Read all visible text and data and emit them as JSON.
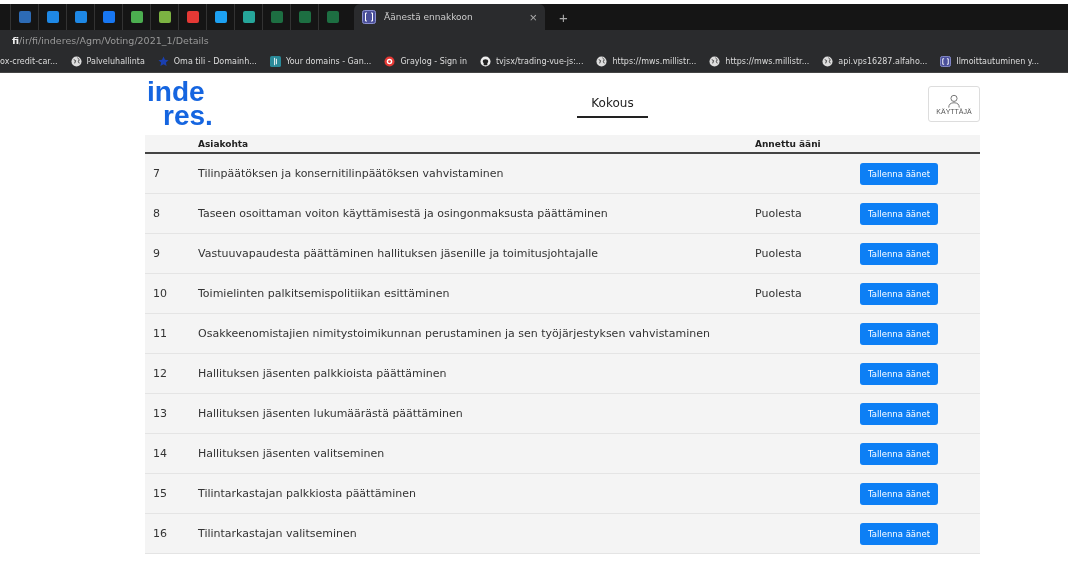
{
  "browser": {
    "pinned_tabs": [
      {
        "color": "#2d6bb5"
      },
      {
        "color": "#1e88e5"
      },
      {
        "color": "#1e88e5"
      },
      {
        "color": "#1877f2"
      },
      {
        "color": "#4caf50"
      },
      {
        "color": "#7cb342"
      },
      {
        "color": "#e53935"
      },
      {
        "color": "#1da1f2"
      },
      {
        "color": "#26a69a"
      },
      {
        "color": "#1d6f42"
      },
      {
        "color": "#1d6f42"
      },
      {
        "color": "#1d6f42"
      }
    ],
    "active_tab": {
      "title": "Äänestä ennakkoon",
      "close": "×"
    },
    "new_tab": "+",
    "address": "**fi**/ir/fi/inderes/Agm/Voting/2021_1/Details",
    "bookmarks": [
      {
        "kind": "none",
        "label": "ox-credit-car..."
      },
      {
        "kind": "globe",
        "label": "Palveluhallinta"
      },
      {
        "kind": "star",
        "label": "Oma tili - Domainh..."
      },
      {
        "kind": "tile",
        "label": "Your domains - Gan..."
      },
      {
        "kind": "target",
        "label": "Graylog - Sign in"
      },
      {
        "kind": "github",
        "label": "tvjsx/trading-vue-js:..."
      },
      {
        "kind": "globe",
        "label": "https://mws.millistr..."
      },
      {
        "kind": "globe",
        "label": "https://mws.millistr..."
      },
      {
        "kind": "globe",
        "label": "api.vps16287.alfaho..."
      },
      {
        "kind": "bracket",
        "label": "Ilmoittautuminen y..."
      }
    ]
  },
  "header": {
    "logo_top": "inde",
    "logo_bottom": "res.",
    "nav": [
      {
        "label": "Kokous",
        "selected": true
      }
    ],
    "user": "KÄYTTÄJÄ"
  },
  "table": {
    "columns": [
      "Asiakohta",
      "Annettu ääni"
    ],
    "rows": [
      {
        "number": "7",
        "item": "Tilinpäätöksen ja konsernitilinpäätöksen vahvistaminen",
        "button": "Tallenna äänet"
      },
      {
        "number": "8",
        "item": "Taseen osoittaman voiton käyttämisestä ja osingonmaksusta päättäminen",
        "vote": "Puolesta",
        "button": "Tallenna äänet"
      },
      {
        "number": "9",
        "item": "Vastuuvapaudesta päättäminen hallituksen jäsenille ja toimitusjohtajalle",
        "vote": "Puolesta",
        "button": "Tallenna äänet"
      },
      {
        "number": "10",
        "item": "Toimielinten palkitsemispolitiikan esittäminen",
        "vote": "Puolesta",
        "button": "Tallenna äänet"
      },
      {
        "number": "11",
        "item": "Osakkeenomistajien nimitystoimikunnan perustaminen ja sen työjärjestyksen vahvistaminen",
        "button": "Tallenna äänet"
      },
      {
        "number": "12",
        "item": "Hallituksen jäsenten palkkioista päättäminen",
        "button": "Tallenna äänet"
      },
      {
        "number": "13",
        "item": "Hallituksen jäsenten lukumäärästä päättäminen",
        "button": "Tallenna äänet"
      },
      {
        "number": "14",
        "item": "Hallituksen jäsenten valitseminen",
        "button": "Tallenna äänet"
      },
      {
        "number": "15",
        "item": "Tilintarkastajan palkkiosta päättäminen",
        "button": "Tallenna äänet"
      },
      {
        "number": "16",
        "item": "Tilintarkastajan valitseminen",
        "button": "Tallenna äänet"
      }
    ]
  }
}
